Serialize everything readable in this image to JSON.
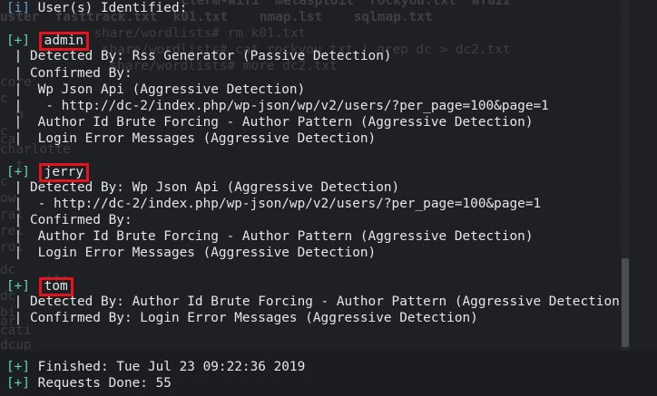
{
  "header": {
    "prefix": "[i]",
    "text": " User(s) Identified:"
  },
  "background_text": [
    "        cterm-wifi  metasploit  rockyou.txt  wfuzz",
    "uster  fasttrack.txt  k01.txt    nmap.lst    sqlmap.txt",
    "     share/wordlists# rm k01.txt",
    "      share/wordlists# cat rockyou.txt | grep dc > dc2.txt",
    "       share/wordlists# more dc2.txt",
    "core",
    "c",
    "  n",
    "c   ",
    "ca",
    "charlotte",
    "  t",
    "c",
    "ow",
    "ral",
    "rel",
    "rol",
    "     ",
    "dc",
    "ite",
    "dc",
    "bi",
    "ar",
    "cati",
    "dcup"
  ],
  "users": [
    {
      "prefix": "[+]",
      "name": "admin",
      "lines": [
        " | Detected By: Rss Generator (Passive Detection)",
        " | Confirmed By:",
        " |  Wp Json Api (Aggressive Detection)",
        " |   - http://dc-2/index.php/wp-json/wp/v2/users/?per_page=100&page=1",
        " |  Author Id Brute Forcing - Author Pattern (Aggressive Detection)",
        " |  Login Error Messages (Aggressive Detection)"
      ]
    },
    {
      "prefix": "[+]",
      "name": "jerry",
      "lines": [
        " | Detected By: Wp Json Api (Aggressive Detection)",
        " |  - http://dc-2/index.php/wp-json/wp/v2/users/?per_page=100&page=1",
        " | Confirmed By:",
        " |  Author Id Brute Forcing - Author Pattern (Aggressive Detection)",
        " |  Login Error Messages (Aggressive Detection)"
      ]
    },
    {
      "prefix": "[+]",
      "name": "tom",
      "lines": [
        " | Detected By: Author Id Brute Forcing - Author Pattern (Aggressive Detection)",
        " | Confirmed By: Login Error Messages (Aggressive Detection)"
      ]
    }
  ],
  "footer": {
    "finished_prefix": "[+]",
    "finished_text": " Finished: Tue Jul 23 09:22:36 2019",
    "requests_prefix": "[+]",
    "requests_text": " Requests Done: 55"
  },
  "colors": {
    "highlight_box": "#e5141c",
    "success_prefix": "#5fd7af",
    "info_prefix": "#6a9fd8"
  }
}
